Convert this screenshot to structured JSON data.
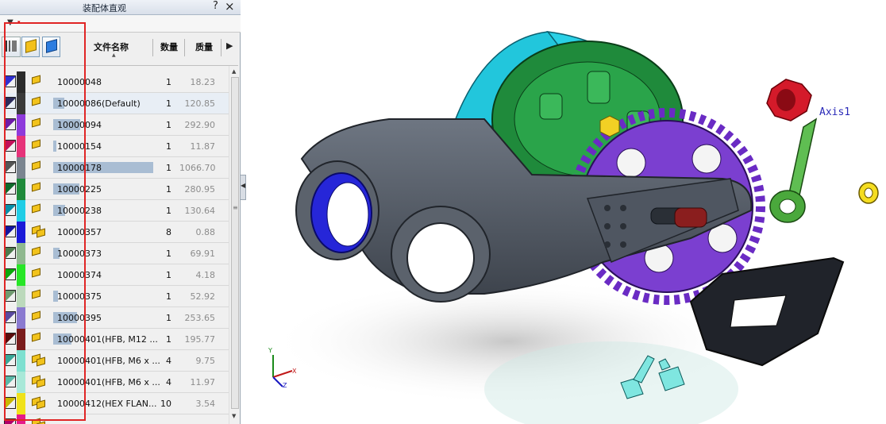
{
  "panel": {
    "title": "装配体直观",
    "help_label": "?",
    "close_label": "×"
  },
  "columns": {
    "name": "文件名称",
    "qty": "数量",
    "mass": "质量"
  },
  "rows": [
    {
      "name": "10000048",
      "qty": "1",
      "mass": "18.23",
      "color": "#2b2b2b",
      "tag": "#2f2fd0",
      "bar_frac": 0.0,
      "multi": false
    },
    {
      "name": "10000086(Default)",
      "qty": "1",
      "mass": "120.85",
      "color": "#3a3a3a",
      "tag": "#2b2b5a",
      "bar_frac": 0.11,
      "multi": false
    },
    {
      "name": "10000094",
      "qty": "1",
      "mass": "292.90",
      "color": "#8e3adb",
      "tag": "#6e1aa8",
      "bar_frac": 0.27,
      "multi": false
    },
    {
      "name": "10000154",
      "qty": "1",
      "mass": "11.87",
      "color": "#e6337a",
      "tag": "#c21058",
      "bar_frac": 0.01,
      "multi": false
    },
    {
      "name": "10000178",
      "qty": "1",
      "mass": "1066.70",
      "color": "#7b8590",
      "tag": "#555555",
      "bar_frac": 1.0,
      "multi": false
    },
    {
      "name": "10000225",
      "qty": "1",
      "mass": "280.95",
      "color": "#1f8a3b",
      "tag": "#0f6a2b",
      "bar_frac": 0.26,
      "multi": false
    },
    {
      "name": "10000238",
      "qty": "1",
      "mass": "130.64",
      "color": "#20cde6",
      "tag": "#0a8fa8",
      "bar_frac": 0.12,
      "multi": false
    },
    {
      "name": "10000357",
      "qty": "8",
      "mass": "0.88",
      "color": "#1a1ad8",
      "tag": "#1414a0",
      "bar_frac": 0.0,
      "multi": true
    },
    {
      "name": "10000373",
      "qty": "1",
      "mass": "69.91",
      "color": "#8fb88f",
      "tag": "#4c7a4c",
      "bar_frac": 0.06,
      "multi": false
    },
    {
      "name": "10000374",
      "qty": "1",
      "mass": "4.18",
      "color": "#27e627",
      "tag": "#0aa80a",
      "bar_frac": 0.0,
      "multi": false
    },
    {
      "name": "10000375",
      "qty": "1",
      "mass": "52.92",
      "color": "#bcd9bc",
      "tag": "#6f9a6f",
      "bar_frac": 0.05,
      "multi": false
    },
    {
      "name": "10000395",
      "qty": "1",
      "mass": "253.65",
      "color": "#8a7ad0",
      "tag": "#5a4aa0",
      "bar_frac": 0.24,
      "multi": false
    },
    {
      "name": "10000401(HFB, M12 ...",
      "qty": "1",
      "mass": "195.77",
      "color": "#7a1c1c",
      "tag": "#5a0c0c",
      "bar_frac": 0.18,
      "multi": false
    },
    {
      "name": "10000401(HFB, M6 x ...",
      "qty": "4",
      "mass": "9.75",
      "color": "#7ee0d0",
      "tag": "#3aa898",
      "bar_frac": 0.0,
      "multi": true
    },
    {
      "name": "10000401(HFB, M6 x ...",
      "qty": "4",
      "mass": "11.97",
      "color": "#a8e8d8",
      "tag": "#5ab8a8",
      "bar_frac": 0.0,
      "multi": true
    },
    {
      "name": "10000412(HEX FLAN...",
      "qty": "10",
      "mass": "3.54",
      "color": "#f0e21a",
      "tag": "#c8b800",
      "bar_frac": 0.0,
      "multi": true
    },
    {
      "name": "",
      "qty": "",
      "mass": "",
      "color": "#e61a8a",
      "tag": "#b0006a",
      "bar_frac": 0.0,
      "multi": true
    }
  ],
  "viewport": {
    "axis_label": "Axis1",
    "triad": {
      "x": "X",
      "y": "Y",
      "z": "Z"
    }
  },
  "colors": {
    "accent": "#e02525",
    "axis_blue": "#2a2ab8"
  }
}
